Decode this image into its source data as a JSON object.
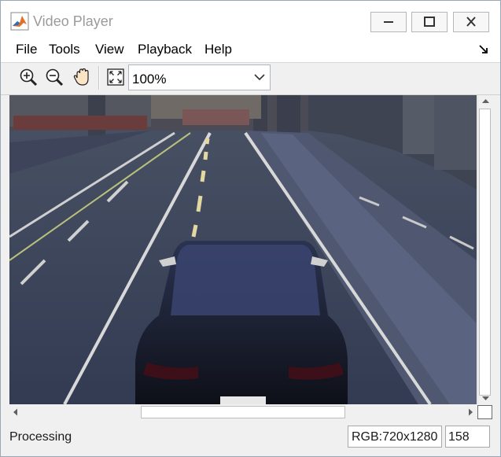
{
  "window": {
    "title": "Video Player"
  },
  "menu": {
    "items": [
      "File",
      "Tools",
      "View",
      "Playback",
      "Help"
    ]
  },
  "toolbar": {
    "zoom_value": "100%"
  },
  "status": {
    "text": "Processing",
    "rgb": "RGB:720x1280",
    "frame": "158"
  },
  "colors": {
    "title_text": "#9b9b9b",
    "road": "#37405a",
    "lane_lines": "#d8d8d8",
    "dashed_line": "#e3d8a0",
    "car": "#14161f"
  },
  "icons": [
    "matlab-app-icon",
    "minimize-icon",
    "maximize-icon",
    "close-icon",
    "undock-arrow-icon",
    "zoom-in-icon",
    "zoom-out-icon",
    "pan-hand-icon",
    "fit-to-window-icon",
    "chevron-down-icon"
  ]
}
